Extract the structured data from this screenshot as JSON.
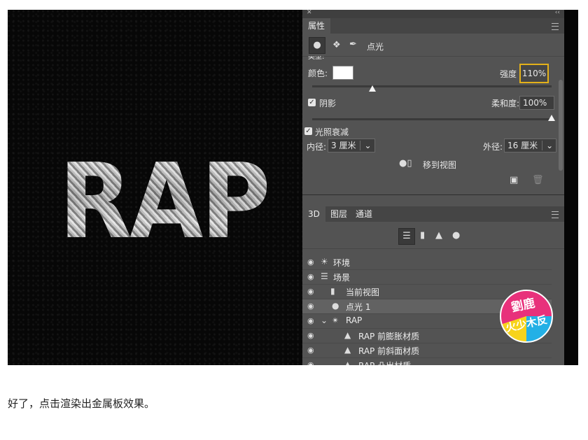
{
  "canvas": {
    "art_text": "RAP"
  },
  "properties": {
    "tab_label": "属性",
    "type_label": "点光",
    "cut_label": "类型:",
    "color_label": "颜色:",
    "color_value": "#ffffff",
    "intensity_label": "强度",
    "intensity_value": "110%",
    "intensity_level": 0.25,
    "shadow_label": "阴影",
    "softness_label": "柔和度:",
    "softness_value": "100%",
    "softness_level": 1.0,
    "falloff_label": "光照衰减",
    "inner_label": "内径:",
    "inner_value": "3 厘米",
    "outer_label": "外径:",
    "outer_value": "16 厘米",
    "move_to_view_label": "移到视图"
  },
  "panel3d": {
    "tabs": [
      "3D",
      "图层",
      "通道"
    ],
    "rows": [
      {
        "label": "环境",
        "icon": "environment-icon"
      },
      {
        "label": "场景",
        "icon": "scene-icon"
      },
      {
        "label": "当前视图",
        "icon": "camera-icon"
      },
      {
        "label": "点光 1",
        "icon": "bulb-icon"
      },
      {
        "label": "RAP",
        "icon": "mesh-icon"
      },
      {
        "label": "RAP 前膨胀材质",
        "icon": "material-icon"
      },
      {
        "label": "RAP 前斜面材质",
        "icon": "material-icon"
      },
      {
        "label": "RAP 凸出材质",
        "icon": "material-icon"
      }
    ]
  },
  "watermark": {
    "text_top": "劉鹿",
    "text_bottom": "火少木反"
  },
  "caption": "好了，点击渲染出金属板效果。",
  "colors": {
    "highlight": "#e3b11a",
    "panel": "#535353"
  }
}
